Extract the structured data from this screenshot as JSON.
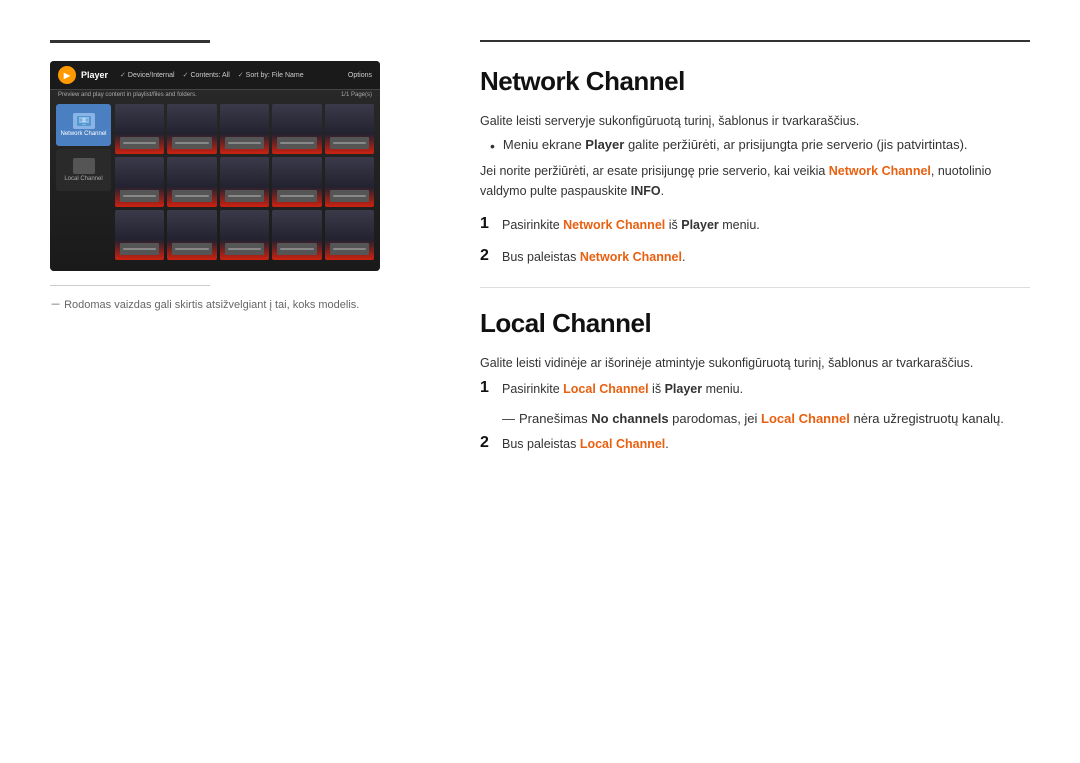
{
  "left": {
    "screen_note": "Rodomas vaizdas gali skirtis atsižvelgiant į tai, koks modelis."
  },
  "right": {
    "network_channel": {
      "title": "Network Channel",
      "intro": "Galite leisti serveryje sukonfigūruotą turinį, šablonus ir tvarkaraščius.",
      "bullet1_prefix": "Meniu ekrane ",
      "bullet1_player": "Player",
      "bullet1_mid": " galite peržiūrėti, ar prisijungta prie serverio (jis patvirtintas).",
      "info_prefix": "Jei norite peržiūrėti, ar esate prisijungę prie serverio, kai veikia ",
      "info_network": "Network Channel",
      "info_mid": ", nuotolinio valdymo pulte paspauskite ",
      "info_bold": "INFO",
      "info_end": ".",
      "step1_number": "1",
      "step1_prefix": "Pasirinkite ",
      "step1_network": "Network Channel",
      "step1_mid": " iš ",
      "step1_player": "Player",
      "step1_suffix": " meniu.",
      "step2_number": "2",
      "step2_prefix": "Bus paleistas ",
      "step2_network": "Network Channel",
      "step2_suffix": "."
    },
    "local_channel": {
      "title": "Local Channel",
      "intro": "Galite leisti vidinėje ar išorinėje atmintyje sukonfigūruotą turinį, šablonus ar tvarkaraščius.",
      "step1_number": "1",
      "step1_prefix": "Pasirinkite ",
      "step1_local": "Local Channel",
      "step1_mid": " iš ",
      "step1_player": "Player",
      "step1_suffix": " meniu.",
      "note_prefix": "Pranešimas ",
      "note_no_channels": "No channels",
      "note_mid": " parodomas, jei ",
      "note_local": "Local Channel",
      "note_suffix": " nėra užregistruotų kanalų.",
      "step2_number": "2",
      "step2_prefix": "Bus paleistas ",
      "step2_local": "Local Channel",
      "step2_suffix": "."
    }
  }
}
